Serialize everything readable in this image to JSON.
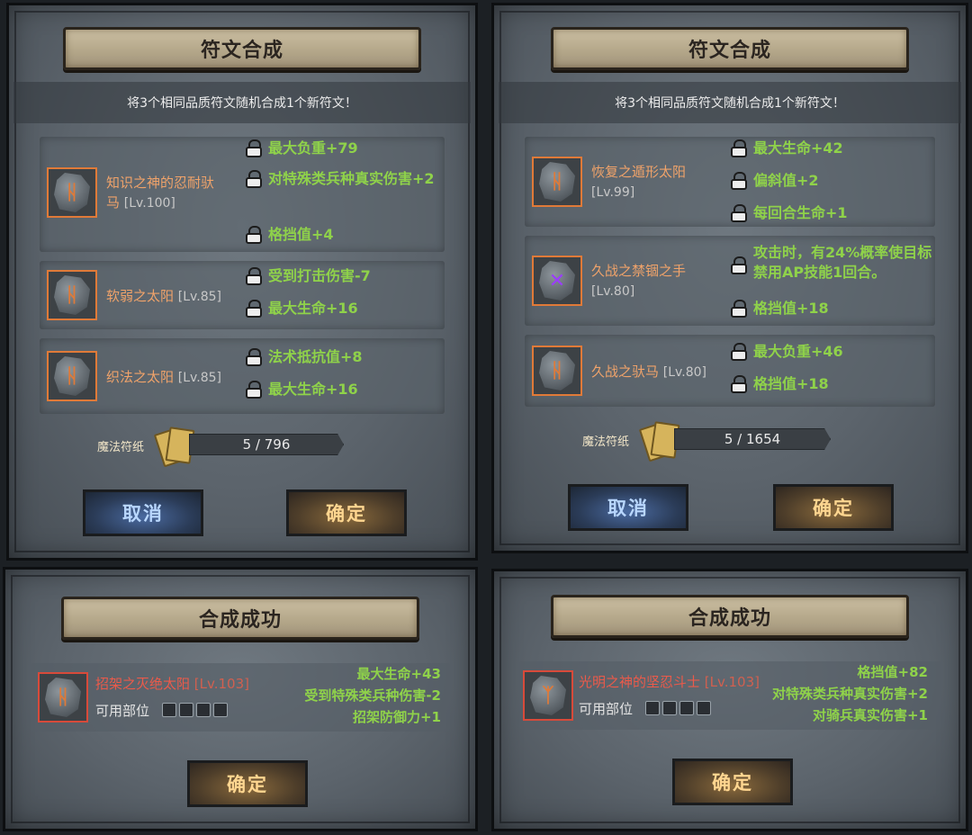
{
  "colors": {
    "attr_green": "#8fd24a",
    "rune_name_orange": "#f0a36a",
    "success_name_red": "#ec5a4a",
    "rune_border_orange": "#e07a38"
  },
  "panels": [
    {
      "title": "符文合成",
      "subtitle": "将3个相同品质符文随机合成1个新符文！",
      "runes": [
        {
          "name": "知识之神的忍耐驮马",
          "lv": "[Lv.100]",
          "glyph": "ᚺ",
          "glyph_color": "#e07a38",
          "attrs": [
            "最大负重+79",
            "对特殊类兵种真实伤害+2",
            "格挡值+4"
          ]
        },
        {
          "name": "软弱之太阳",
          "lv": "[Lv.85]",
          "glyph": "ᚺ",
          "glyph_color": "#e07a38",
          "attrs": [
            "受到打击伤害-7",
            "最大生命+16"
          ]
        },
        {
          "name": "织法之太阳",
          "lv": "[Lv.85]",
          "glyph": "ᚺ",
          "glyph_color": "#e07a38",
          "attrs": [
            "法术抵抗值+8",
            "最大生命+16"
          ]
        }
      ],
      "paper_label": "魔法符纸",
      "paper_progress": "5 / 796",
      "paper_fraction": 0.006,
      "cancel_label": "取消",
      "confirm_label": "确定"
    },
    {
      "title": "符文合成",
      "subtitle": "将3个相同品质符文随机合成1个新符文！",
      "runes": [
        {
          "name": "恢复之遁形太阳",
          "lv": "[Lv.99]",
          "glyph": "ᚺ",
          "glyph_color": "#e07a38",
          "attrs": [
            "最大生命+42",
            "偏斜值+2",
            "每回合生命+1"
          ]
        },
        {
          "name": "久战之禁锢之手",
          "lv": "[Lv.80]",
          "glyph": "✕",
          "glyph_color": "#9b3cff",
          "attrs": [
            "攻击时，有24%概率使目标禁用AP技能1回合。",
            "格挡值+18"
          ]
        },
        {
          "name": "久战之驮马",
          "lv": "[Lv.80]",
          "glyph": "ᚺ",
          "glyph_color": "#e07a38",
          "attrs": [
            "最大负重+46",
            "格挡值+18"
          ]
        }
      ],
      "paper_label": "魔法符纸",
      "paper_progress": "5 / 1654",
      "paper_fraction": 0.003,
      "cancel_label": "取消",
      "confirm_label": "确定"
    },
    {
      "title": "合成成功",
      "rune": {
        "name": "招架之灭绝太阳",
        "lv": "[Lv.103]",
        "glyph": "ᚺ"
      },
      "slot_label": "可用部位",
      "attrs": [
        "最大生命+43",
        "受到特殊类兵种伤害-2",
        "招架防御力+1"
      ],
      "confirm_label": "确定"
    },
    {
      "title": "合成成功",
      "rune": {
        "name": "光明之神的坚忍斗士",
        "lv": "[Lv.103]",
        "glyph": "ᛉ"
      },
      "slot_label": "可用部位",
      "attrs": [
        "格挡值+82",
        "对特殊类兵种真实伤害+2",
        "对骑兵真实伤害+1"
      ],
      "confirm_label": "确定"
    }
  ]
}
